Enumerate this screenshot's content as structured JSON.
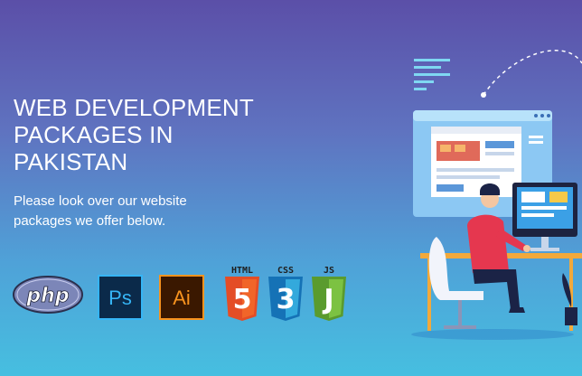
{
  "hero": {
    "title": "WEB DEVELOPMENT\nPACKAGES IN\nPAKISTAN",
    "subtitle": "Please look over our website packages we offer below."
  },
  "logos": {
    "php": "php",
    "ps": "Ps",
    "ai": "Ai",
    "html": "HTML",
    "html_num": "5",
    "css": "CSS",
    "css_num": "3",
    "js": "JS",
    "js_num": "J"
  },
  "colors": {
    "php": "#7c86b8",
    "ps_bg": "#0b2a4a",
    "ps_fg": "#36b5f5",
    "ai_bg": "#3a1800",
    "ai_fg": "#f7931e",
    "html": "#e44d26",
    "css": "#1572b6",
    "js": "#6cb33f"
  }
}
